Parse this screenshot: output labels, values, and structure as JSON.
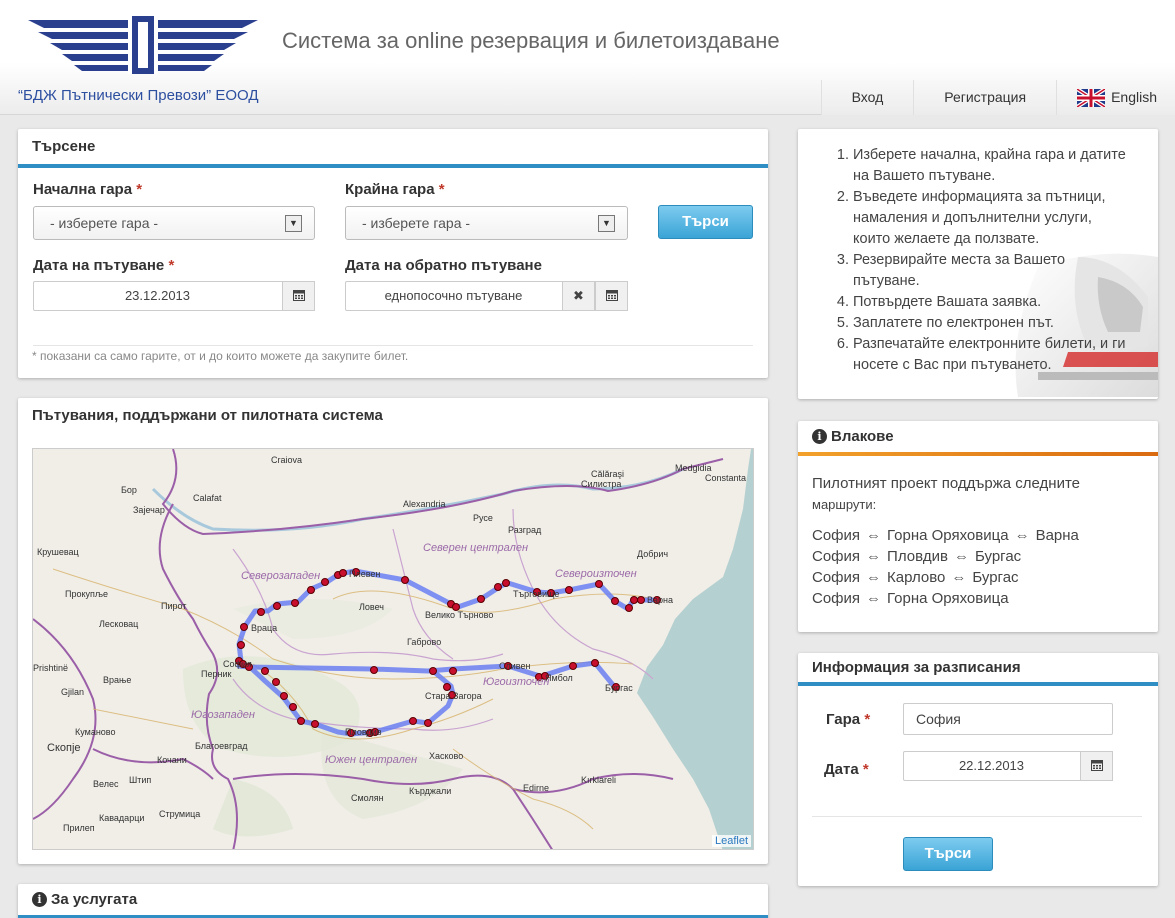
{
  "header": {
    "site_title": "Система за online резервация и билетоиздаване",
    "company": "“БДЖ Пътнически Превози” ЕООД",
    "nav": {
      "login": "Вход",
      "register": "Регистрация",
      "language": "English"
    }
  },
  "search": {
    "title": "Търсене",
    "from_label": "Начална гара",
    "to_label": "Крайна гара",
    "from_value": "- изберете гара -",
    "to_value": "- изберете гара -",
    "date_label": "Дата на пътуване",
    "return_label": "Дата на обратно пътуване",
    "date_value": "23.12.2013",
    "return_value": "еднопосочно пътуване",
    "search_button": "Търси",
    "required_mark": "*",
    "note": "* показани са само гарите, от и до които можете да закупите билет."
  },
  "map_panel": {
    "title": "Пътувания, поддържани от пилотната система",
    "attribution": "Leaflet",
    "labels": {
      "craiova": "Craiova",
      "calarasi": "Călăraşi",
      "silistra": "Силистра",
      "medgidia": "Medgidia",
      "constanta": "Constanta",
      "bor": "Бор",
      "calafat": "Calafat",
      "zaechar": "Зајечар",
      "alexandria": "Alexandria",
      "ruse": "Русе",
      "razgrad": "Разград",
      "dobrich": "Добрич",
      "krushevac": "Крушевац",
      "north_central": "Северен централен",
      "northwest": "Северозападен",
      "northeast": "Североизточен",
      "pleven": "Плевен",
      "lovech": "Ловеч",
      "veliko_tarnovo": "Велико Търново",
      "targovishte": "Търговище",
      "varna": "Варна",
      "prokuplje": "Прокупље",
      "pirot": "Пирот",
      "leskovac": "Лесковац",
      "vratsa": "Враца",
      "gabrovo": "Габрово",
      "pristina": "Prishtinë",
      "sofia": "София",
      "pernik": "Перник",
      "sliven": "Сливен",
      "yambol": "Ямбол",
      "stara_zagora": "Стара Загора",
      "southeast": "Югоизточен",
      "burgas": "Бургас",
      "vranje": "Врање",
      "gjilan": "Gjilan",
      "southwest": "Югозападен",
      "kumanovo": "Куманово",
      "plovdiv": "Пловдив",
      "skopje": "Скопје",
      "blagoevgrad": "Благоевград",
      "haskovo": "Хасково",
      "south_central": "Южен централен",
      "veles": "Велес",
      "kochani": "Кочани",
      "edirne": "Edirne",
      "kirklareli": "Kırklareli",
      "shtip": "Штип",
      "smolyan": "Смолян",
      "kardzhali": "Кърджали",
      "kavadarci": "Кавадарци",
      "strumica": "Струмица",
      "prilep": "Прилеп"
    }
  },
  "steps": {
    "items": [
      "Изберете начална, крайна гара и датите на Вашето пътуване.",
      "Въведете информацията за пътници, намаления и допълнителни услуги, които желаете да ползвате.",
      "Резервирайте места за Вашето пътуване.",
      "Потвърдете Вашата заявка.",
      "Заплатете по електронен път.",
      "Разпечатайте електронните билети, и ги носете с Вас при пътуването."
    ]
  },
  "trains": {
    "title": "Влакове",
    "intro": "Пилотният проект поддържа следните",
    "intro_small": "маршрути:",
    "arrow": "⇔",
    "routes": [
      [
        "София",
        "Горна Оряховица",
        "Варна"
      ],
      [
        "София",
        "Пловдив",
        "Бургас"
      ],
      [
        "София",
        "Карлово",
        "Бургас"
      ],
      [
        "София",
        "Горна Оряховица"
      ]
    ]
  },
  "schedule": {
    "title": "Информация за разписания",
    "station_label": "Гара",
    "station_value": "София",
    "date_label": "Дата",
    "date_value": "22.12.2013",
    "search_button": "Търси"
  },
  "about": {
    "title": "За услугата"
  },
  "icons": {
    "info": "i",
    "calendar": "calendar-icon",
    "clear": "✖",
    "dropdown": "▼"
  }
}
